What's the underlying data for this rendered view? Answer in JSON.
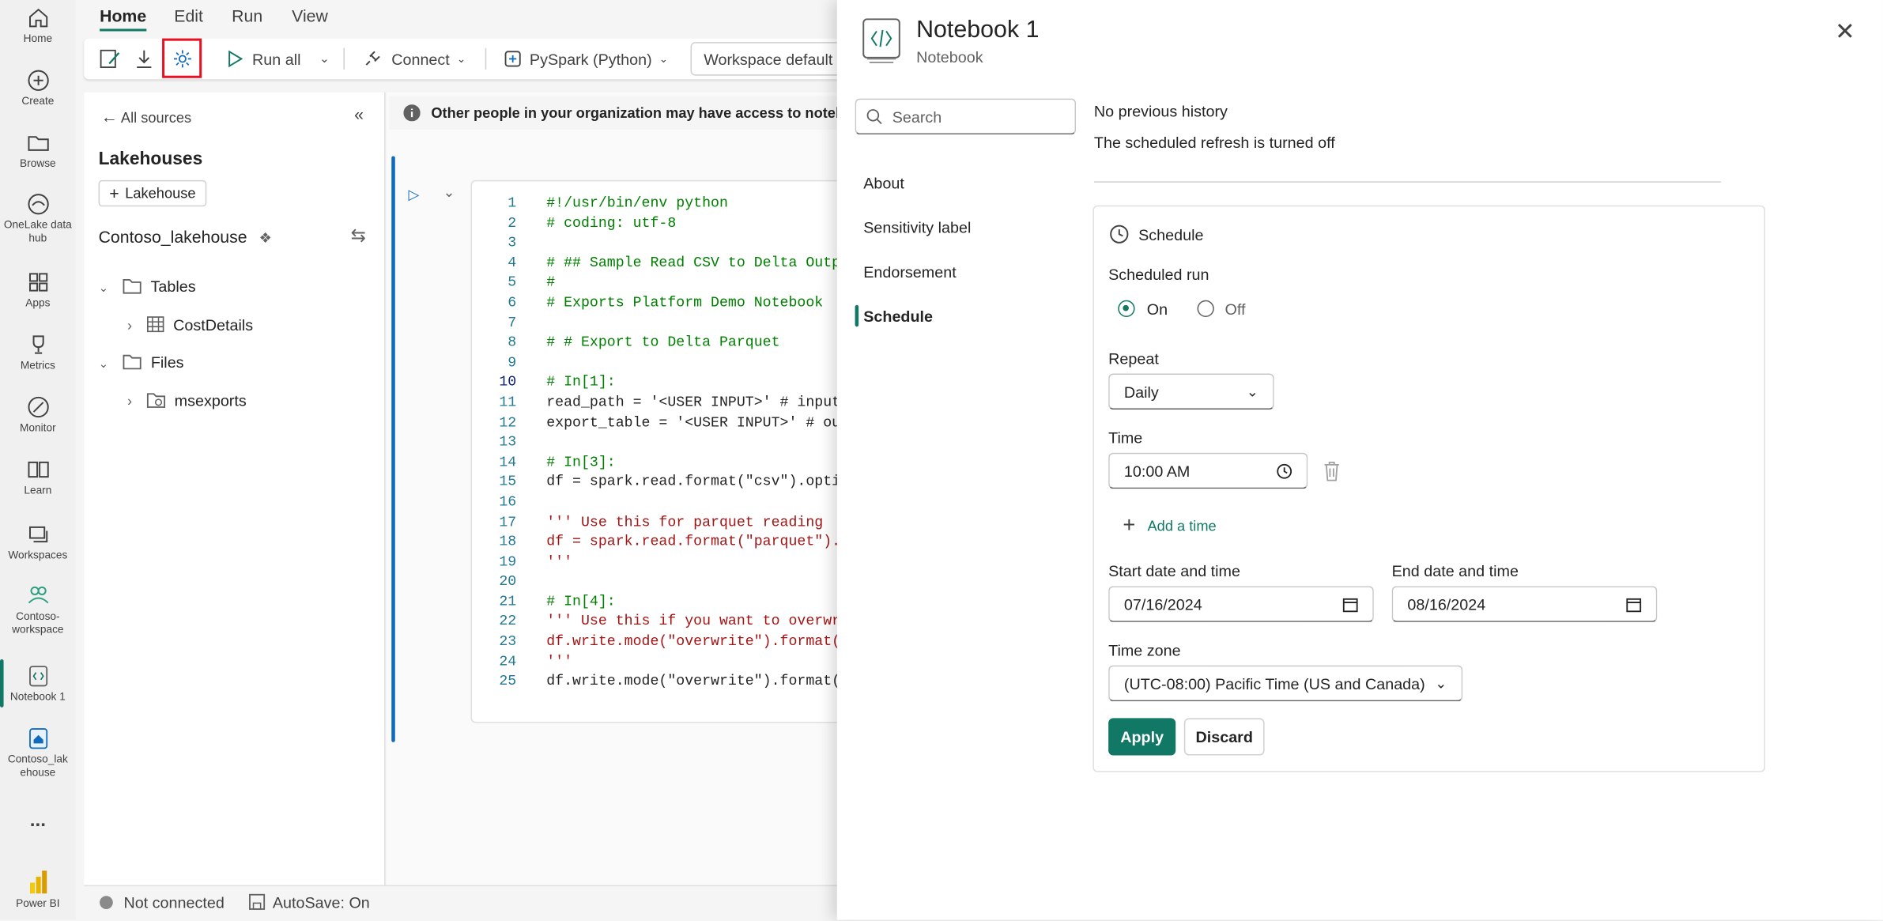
{
  "rail": {
    "items": [
      {
        "label": "Home",
        "icon": "home-icon"
      },
      {
        "label": "Create",
        "icon": "create-icon"
      },
      {
        "label": "Browse",
        "icon": "browse-icon"
      },
      {
        "label": "OneLake data hub",
        "icon": "onelake-icon"
      },
      {
        "label": "Apps",
        "icon": "apps-icon"
      },
      {
        "label": "Metrics",
        "icon": "metrics-icon"
      },
      {
        "label": "Monitor",
        "icon": "monitor-icon"
      },
      {
        "label": "Learn",
        "icon": "learn-icon"
      },
      {
        "label": "Workspaces",
        "icon": "workspaces-icon"
      },
      {
        "label": "Contoso-workspace",
        "icon": "workspace-icon"
      },
      {
        "label": "Notebook 1",
        "icon": "notebook-icon"
      },
      {
        "label": "Contoso_lakehouse",
        "icon": "lakehouse-icon"
      },
      {
        "label": "...",
        "icon": "more-icon"
      },
      {
        "label": "Power BI",
        "icon": "powerbi-icon"
      }
    ]
  },
  "menu": {
    "home": "Home",
    "edit": "Edit",
    "run": "Run",
    "view": "View"
  },
  "toolbar": {
    "run_all": "Run all",
    "connect": "Connect",
    "language": "PySpark (Python)",
    "environment": "Workspace default"
  },
  "explorer": {
    "back": "All sources",
    "section": "Lakehouses",
    "add_lakehouse": "Lakehouse",
    "lakehouse_name": "Contoso_lakehouse",
    "tables": "Tables",
    "table_item": "CostDetails",
    "files": "Files",
    "file_item": "msexports"
  },
  "info_bar": "Other people in your organization may have access to notebooks",
  "code": {
    "line_numbers": [
      "1",
      "2",
      "3",
      "4",
      "5",
      "6",
      "7",
      "8",
      "9",
      "10",
      "11",
      "12",
      "13",
      "14",
      "15",
      "16",
      "17",
      "18",
      "19",
      "20",
      "21",
      "22",
      "23",
      "24",
      "25"
    ],
    "lines": [
      {
        "t": "#!/usr/bin/env python",
        "c": "c"
      },
      {
        "t": "# coding: utf-8",
        "c": "c"
      },
      {
        "t": "",
        "c": "c"
      },
      {
        "t": "# ## Sample Read CSV to Delta Outp",
        "c": "c"
      },
      {
        "t": "#",
        "c": "c"
      },
      {
        "t": "# Exports Platform Demo Notebook",
        "c": "c"
      },
      {
        "t": "",
        "c": "c"
      },
      {
        "t": "# # Export to Delta Parquet",
        "c": "c"
      },
      {
        "t": "",
        "c": "c"
      },
      {
        "t": "# In[1]:",
        "c": "c"
      },
      {
        "t": "read_path = '<USER INPUT>' # input",
        "c": "m"
      },
      {
        "t": "export_table = '<USER INPUT>' # ou",
        "c": "m"
      },
      {
        "t": "",
        "c": "c"
      },
      {
        "t": "# In[3]:",
        "c": "c"
      },
      {
        "t": "df = spark.read.format(\"csv\").opti",
        "c": "m"
      },
      {
        "t": "",
        "c": "c"
      },
      {
        "t": "''' Use this for parquet reading",
        "c": "s"
      },
      {
        "t": "df = spark.read.format(\"parquet\").",
        "c": "s"
      },
      {
        "t": "'''",
        "c": "s"
      },
      {
        "t": "",
        "c": "c"
      },
      {
        "t": "# In[4]:",
        "c": "c"
      },
      {
        "t": "''' Use this if you want to overwr",
        "c": "s"
      },
      {
        "t": "df.write.mode(\"overwrite\").format(",
        "c": "s"
      },
      {
        "t": "'''",
        "c": "s"
      },
      {
        "t": "df.write.mode(\"overwrite\").format(",
        "c": "m"
      }
    ]
  },
  "status": {
    "connection": "Not connected",
    "autosave": "AutoSave: On"
  },
  "panel": {
    "title": "Notebook 1",
    "subtitle": "Notebook",
    "search_placeholder": "Search",
    "nav": [
      "About",
      "Sensitivity label",
      "Endorsement",
      "Schedule"
    ],
    "history": "No previous history",
    "refresh_status": "The scheduled refresh is turned off",
    "schedule_header": "Schedule",
    "scheduled_run_label": "Scheduled run",
    "on_label": "On",
    "off_label": "Off",
    "scheduled_run": "On",
    "repeat_label": "Repeat",
    "repeat_value": "Daily",
    "time_label": "Time",
    "time_value": "10:00 AM",
    "add_time": "Add a time",
    "start_label": "Start date and time",
    "start_value": "07/16/2024",
    "end_label": "End date and time",
    "end_value": "08/16/2024",
    "timezone_label": "Time zone",
    "timezone_value": "(UTC-08:00) Pacific Time (US and Canada)",
    "apply": "Apply",
    "discard": "Discard"
  },
  "colors": {
    "accent": "#117865",
    "highlight_box": "#e81123",
    "comment": "#008000",
    "string": "#a31515",
    "code": "#242424"
  }
}
